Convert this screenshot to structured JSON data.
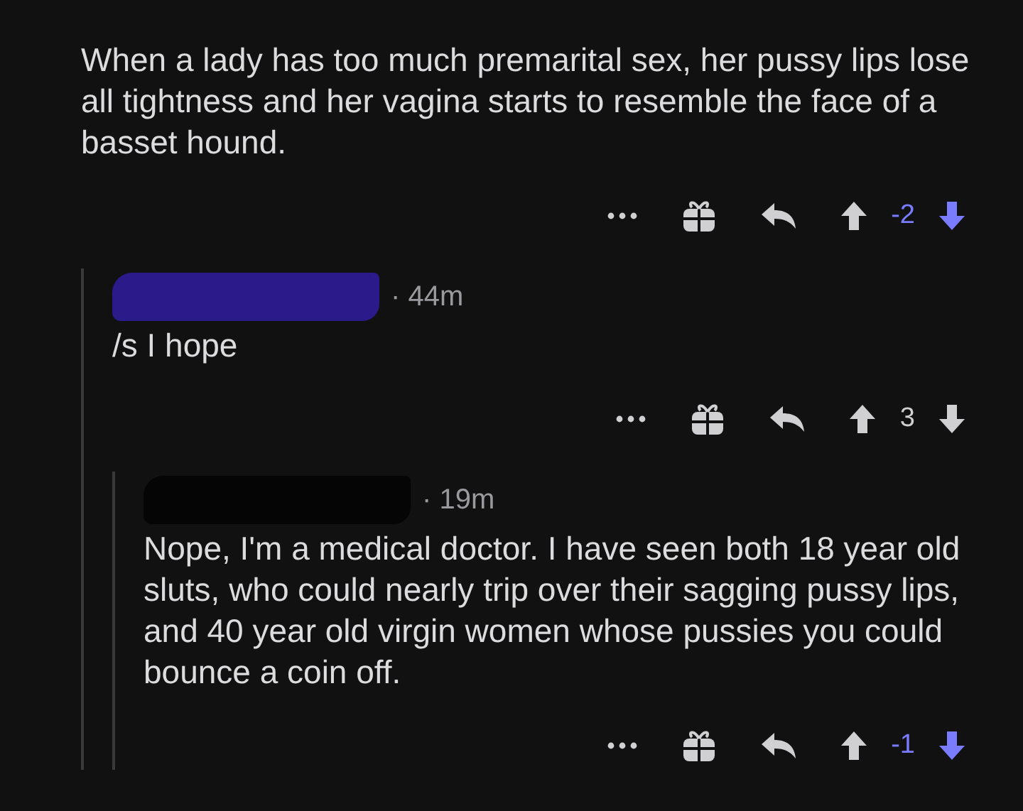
{
  "comments": [
    {
      "body": "When a lady has too much premarital sex, her pussy lips lose all tightness and her vagina starts to resemble the face of a basset hound.",
      "score": "-2",
      "upvoted": false,
      "downvoted": true,
      "children": [
        {
          "header": {
            "redaction": {
              "color": "#2a1a8a"
            },
            "age": "· 44m"
          },
          "body": "/s I hope",
          "score": "3",
          "upvoted": false,
          "downvoted": false,
          "children": [
            {
              "header": {
                "redaction": {
                  "color": "#050505"
                },
                "age": "· 19m"
              },
              "body": "Nope, I'm a medical doctor. I have seen both 18 year old sluts, who could nearly trip over their sagging pussy lips, and 40 year old virgin women whose pussies you could bounce a coin off.",
              "score": "-1",
              "upvoted": false,
              "downvoted": true
            }
          ]
        }
      ]
    }
  ]
}
